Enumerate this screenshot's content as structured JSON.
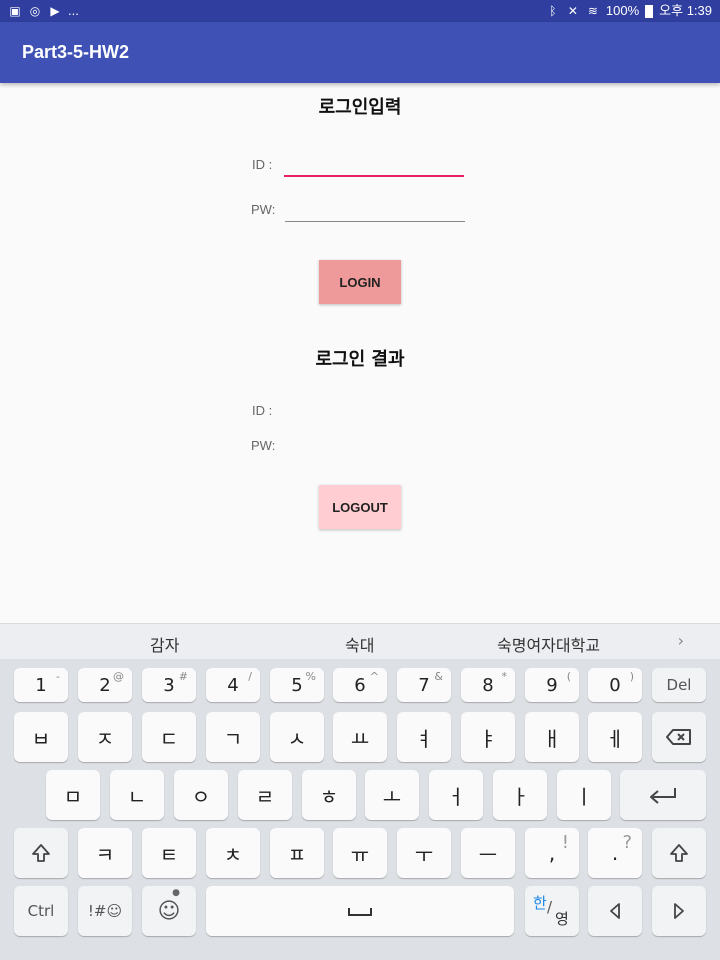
{
  "status_bar": {
    "left_icons": [
      "image-icon",
      "sync-icon",
      "play-icon"
    ],
    "left_more": "...",
    "right_icons": [
      "bluetooth-icon",
      "mute-icon",
      "wifi-icon"
    ],
    "battery": "100%",
    "time": "오후 1:39"
  },
  "app": {
    "title": "Part3-5-HW2"
  },
  "login": {
    "heading": "로그인입력",
    "id_label": "ID :",
    "id_value": "",
    "pw_label": "PW:",
    "pw_value": "",
    "button": "LOGIN"
  },
  "result": {
    "heading": "로그인 결과",
    "id_label": "ID :",
    "id_value": "",
    "pw_label": "PW:",
    "pw_value": "",
    "button": "LOGOUT"
  },
  "keyboard": {
    "suggestions": [
      "감자",
      "숙대",
      "숙명여자대학교"
    ],
    "more_arrow": "›",
    "row1": [
      {
        "main": "1",
        "sup": "-"
      },
      {
        "main": "2",
        "sup": "@"
      },
      {
        "main": "3",
        "sup": "#"
      },
      {
        "main": "4",
        "sup": "/"
      },
      {
        "main": "5",
        "sup": "%"
      },
      {
        "main": "6",
        "sup": "^"
      },
      {
        "main": "7",
        "sup": "&"
      },
      {
        "main": "8",
        "sup": "*"
      },
      {
        "main": "9",
        "sup": "("
      },
      {
        "main": "0",
        "sup": ")"
      }
    ],
    "del_label": "Del",
    "row2": [
      "ㅂ",
      "ㅈ",
      "ㄷ",
      "ㄱ",
      "ㅅ",
      "ㅛ",
      "ㅕ",
      "ㅑ",
      "ㅐ",
      "ㅔ"
    ],
    "row3": [
      "ㅁ",
      "ㄴ",
      "ㅇ",
      "ㄹ",
      "ㅎ",
      "ㅗ",
      "ㅓ",
      "ㅏ",
      "ㅣ"
    ],
    "row4": [
      "ㅋ",
      "ㅌ",
      "ㅊ",
      "ㅍ",
      "ㅠ",
      "ㅜ",
      "ㅡ"
    ],
    "comma": {
      "main": ",",
      "sup": "!"
    },
    "period": {
      "main": ".",
      "sup": "?"
    },
    "ctrl_label": "Ctrl",
    "symbols_label": "!#☺",
    "lang_hangul": "한",
    "lang_english": "영"
  }
}
